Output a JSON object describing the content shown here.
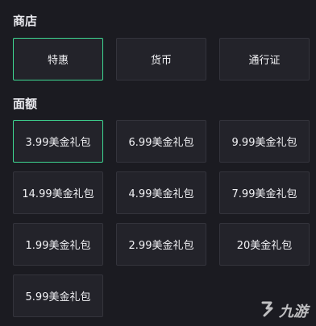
{
  "shop": {
    "title": "商店",
    "tabs": [
      {
        "label": "特惠",
        "selected": true
      },
      {
        "label": "货币",
        "selected": false
      },
      {
        "label": "通行证",
        "selected": false
      }
    ]
  },
  "denomination": {
    "title": "面额",
    "options": [
      {
        "label": "3.99美金礼包",
        "selected": true
      },
      {
        "label": "6.99美金礼包",
        "selected": false
      },
      {
        "label": "9.99美金礼包",
        "selected": false
      },
      {
        "label": "14.99美金礼包",
        "selected": false
      },
      {
        "label": "4.99美金礼包",
        "selected": false
      },
      {
        "label": "7.99美金礼包",
        "selected": false
      },
      {
        "label": "1.99美金礼包",
        "selected": false
      },
      {
        "label": "2.99美金礼包",
        "selected": false
      },
      {
        "label": "20美金礼包",
        "selected": false
      },
      {
        "label": "5.99美金礼包",
        "selected": false
      }
    ]
  },
  "watermark": {
    "text": "九游"
  },
  "colors": {
    "accent": "#3ed892",
    "background": "#1b1b21",
    "tile": "#23232a"
  }
}
